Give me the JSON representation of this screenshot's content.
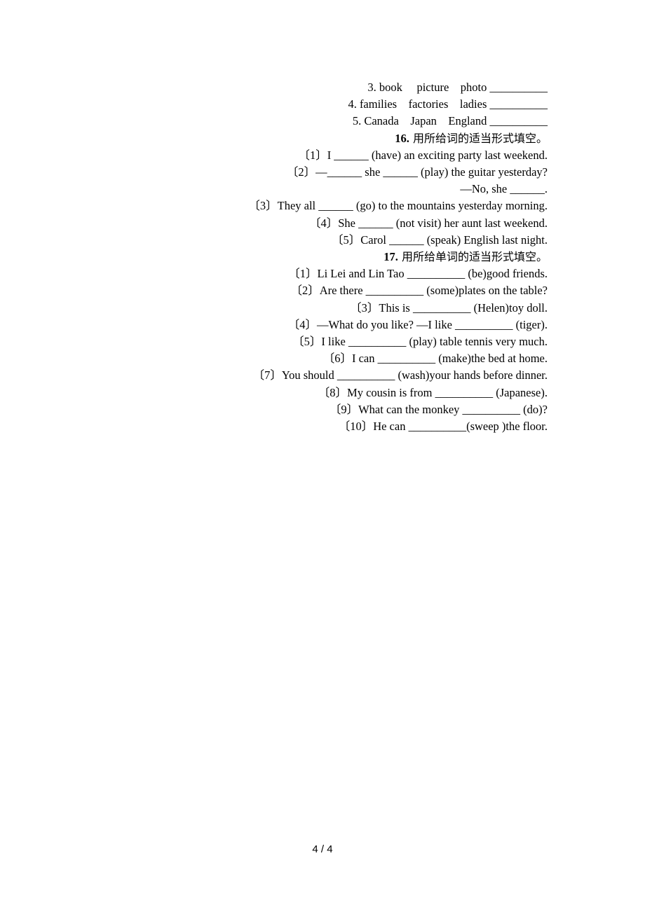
{
  "section15_tail": [
    "3. book     picture    photo __________",
    "4. families    factories    ladies __________",
    "5. Canada    Japan    England __________"
  ],
  "section16": {
    "number": "16.",
    "instruction": " 用所给词的适当形式填空。",
    "items": [
      "〔1〕I ______ (have) an exciting party last weekend.",
      "〔2〕—______ she ______ (play) the guitar yesterday?",
      "—No, she ______.",
      "〔3〕They all ______ (go) to the mountains yesterday morning.",
      "〔4〕She ______ (not visit) her aunt last weekend.",
      "〔5〕Carol ______ (speak) English last night."
    ]
  },
  "section17": {
    "number": "17.",
    "instruction": " 用所给单词的适当形式填空。",
    "items": [
      "〔1〕Li Lei and Lin Tao __________ (be)good friends.",
      "〔2〕Are there __________ (some)plates on the table?",
      "〔3〕This is __________ (Helen)toy doll.",
      "〔4〕—What do you like? —I like __________ (tiger).",
      "〔5〕I like __________ (play) table tennis very much.",
      "〔6〕I can __________ (make)the bed at home.",
      "〔7〕You should __________ (wash)your hands before dinner.",
      "〔8〕My cousin is from __________ (Japanese).",
      "〔9〕What can the monkey __________ (do)?",
      "〔10〕He can __________(sweep )the floor."
    ]
  },
  "footer": {
    "page_indicator": "4 / 4"
  }
}
